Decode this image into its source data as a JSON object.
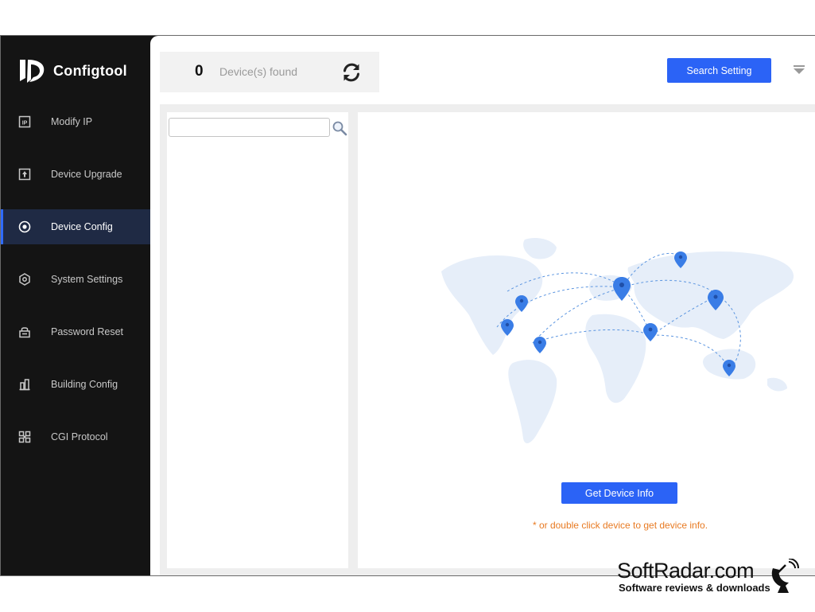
{
  "app": {
    "name": "Configtool"
  },
  "sidebar": {
    "items": [
      {
        "label": "Modify IP",
        "icon": "ip-icon",
        "active": false
      },
      {
        "label": "Device Upgrade",
        "icon": "upgrade-icon",
        "active": false
      },
      {
        "label": "Device Config",
        "icon": "config-target-icon",
        "active": true
      },
      {
        "label": "System Settings",
        "icon": "hexagon-gear-icon",
        "active": false
      },
      {
        "label": "Password Reset",
        "icon": "lock-icon",
        "active": false
      },
      {
        "label": "Building Config",
        "icon": "building-icon",
        "active": false
      },
      {
        "label": "CGI Protocol",
        "icon": "grid-icon",
        "active": false
      }
    ]
  },
  "toolbar": {
    "device_count": "0",
    "device_found_label": "Device(s) found",
    "search_setting_label": "Search Setting"
  },
  "device_list": {
    "search_value": "",
    "search_placeholder": ""
  },
  "detail": {
    "get_info_label": "Get Device Info",
    "hint": "* or double click device to get device info."
  },
  "colors": {
    "accent": "#2b63f6",
    "sidebar_bg": "#141414",
    "active_bg": "#1f2a44",
    "hint": "#e87a22"
  },
  "watermark": {
    "title": "SoftRadar.com",
    "subtitle": "Software reviews & downloads"
  }
}
